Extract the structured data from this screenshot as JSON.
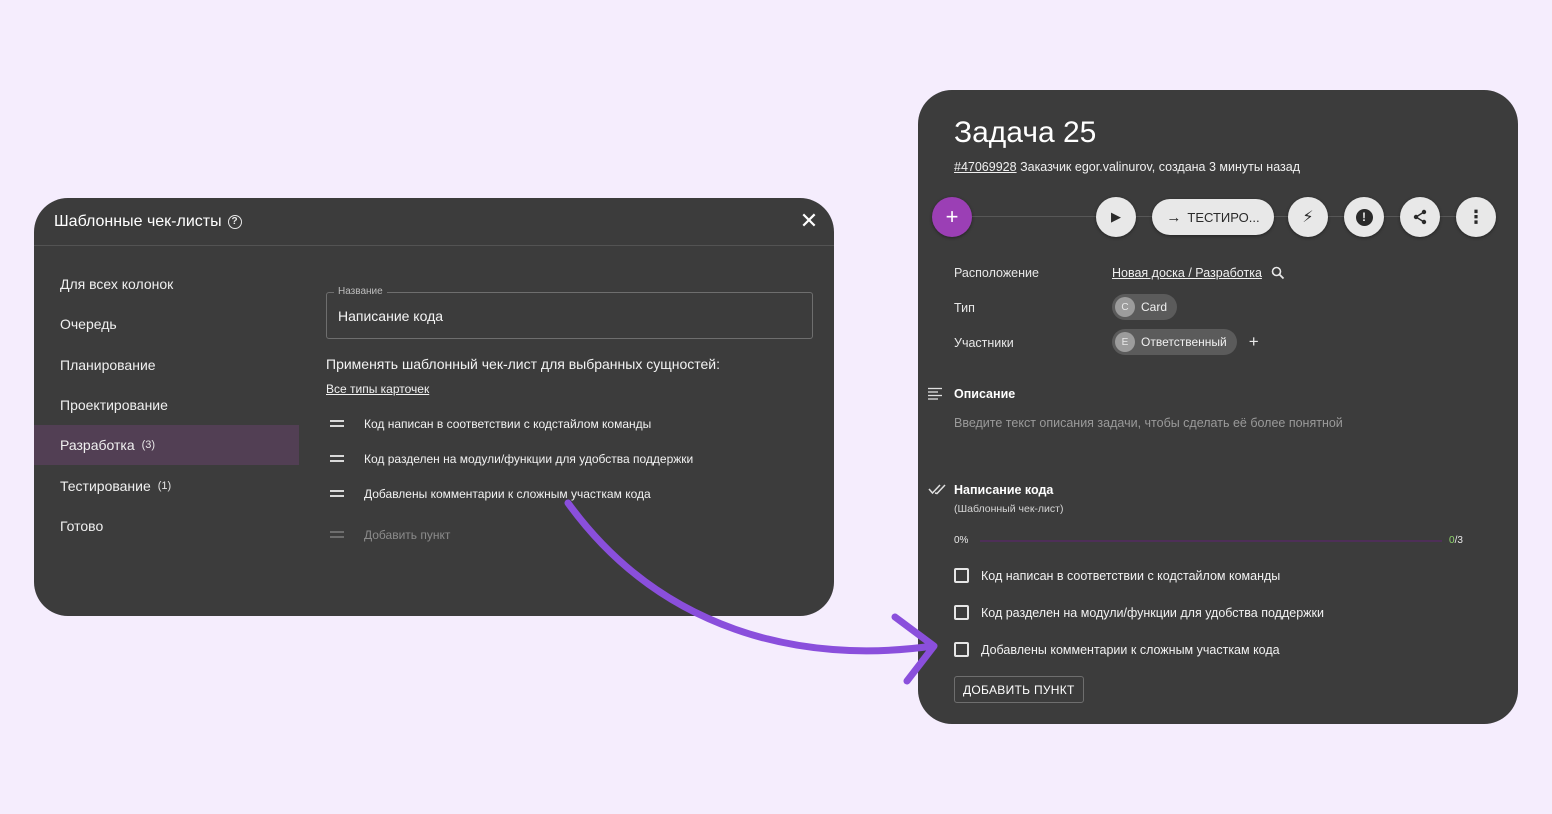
{
  "dialog": {
    "title": "Шаблонные чек-листы",
    "help_glyph": "?",
    "close_glyph": "✕",
    "columns": [
      {
        "label": "Для всех колонок",
        "count": ""
      },
      {
        "label": "Очередь",
        "count": ""
      },
      {
        "label": "Планирование",
        "count": ""
      },
      {
        "label": "Проектирование",
        "count": ""
      },
      {
        "label": "Разработка",
        "count": "(3)"
      },
      {
        "label": "Тестирование",
        "count": "(1)"
      },
      {
        "label": "Готово",
        "count": ""
      }
    ],
    "active_column_index": 4,
    "name_label": "Название",
    "name_value": "Написание кода",
    "apply_text": "Применять шаблонный чек-лист для выбранных сущностей:",
    "all_types_link": "Все типы карточек",
    "items": [
      "Код написан в соответствии с кодстайлом команды",
      "Код разделен на модули/функции для удобства поддержки",
      "Добавлены комментарии к сложным участкам кода"
    ],
    "add_item_placeholder": "Добавить пункт"
  },
  "task": {
    "title": "Задача 25",
    "id_link": "#47069928",
    "customer_prefix": "Заказчик",
    "customer": "egor.valinurov",
    "created": ", создана 3 минуты назад",
    "actions": {
      "add_glyph": "+",
      "play_glyph": "▶",
      "status_arrow": "→",
      "status_label": "ТЕСТИРО...",
      "flash_glyph": "⚡",
      "alert_glyph": "!",
      "share_glyph": "⤴",
      "more_glyph": "⋮"
    },
    "location_label": "Расположение",
    "location_value": "Новая доска / Разработка",
    "type_label": "Тип",
    "type_avatar": "C",
    "type_value": "Card",
    "members_label": "Участники",
    "member_avatar": "E",
    "member_value": "Ответственный",
    "add_member_glyph": "+",
    "description_title": "Описание",
    "description_placeholder": "Введите текст описания задачи, чтобы сделать её более понятной",
    "checklist_title": "Написание кода",
    "checklist_subtitle": "(Шаблонный чек-лист)",
    "progress_percent": "0%",
    "progress_done": "0",
    "progress_total": "/3",
    "progress_fraction": 0,
    "items": [
      "Код написан в соответствии с кодстайлом команды",
      "Код разделен на модули/функции для удобства поддержки",
      "Добавлены комментарии к сложным участкам кода"
    ],
    "add_item_button": "ДОБАВИТЬ ПУНКТ"
  },
  "colors": {
    "background": "#f5edfd",
    "panel": "#3c3c3c",
    "accent": "#9b3fb5",
    "arrow": "#8a4fdc",
    "active_row": "#523f54"
  }
}
